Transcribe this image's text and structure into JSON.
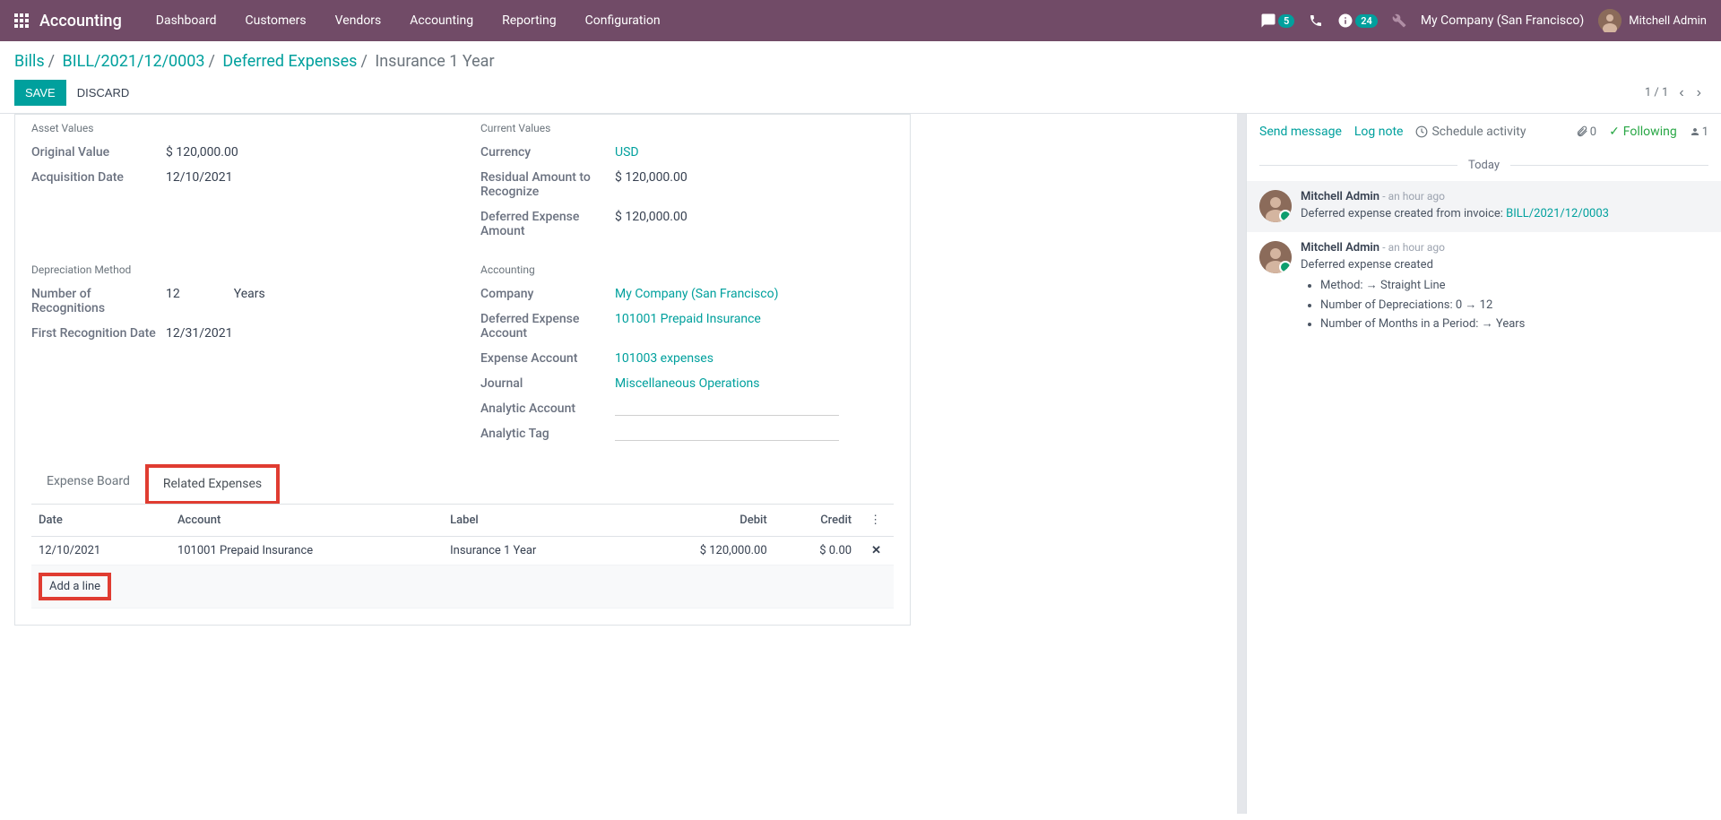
{
  "topbar": {
    "app_title": "Accounting",
    "menus": [
      "Dashboard",
      "Customers",
      "Vendors",
      "Accounting",
      "Reporting",
      "Configuration"
    ],
    "msg_badge": "5",
    "activity_badge": "24",
    "company": "My Company (San Francisco)",
    "user": "Mitchell Admin"
  },
  "breadcrumb": {
    "a": "Bills",
    "b": "BILL/2021/12/0003",
    "c": "Deferred Expenses",
    "d": "Insurance 1 Year"
  },
  "buttons": {
    "save": "Save",
    "discard": "Discard"
  },
  "pager": {
    "text": "1 / 1"
  },
  "sections": {
    "asset_values": "Asset Values",
    "current_values": "Current Values",
    "depreciation_method": "Depreciation Method",
    "accounting": "Accounting"
  },
  "fields": {
    "original_value": {
      "label": "Original Value",
      "value": "$ 120,000.00"
    },
    "acquisition_date": {
      "label": "Acquisition Date",
      "value": "12/10/2021"
    },
    "currency": {
      "label": "Currency",
      "value": "USD"
    },
    "residual": {
      "label": "Residual Amount to Recognize",
      "value": "$ 120,000.00"
    },
    "deferred_amount": {
      "label": "Deferred Expense Amount",
      "value": "$ 120,000.00"
    },
    "num_recognitions": {
      "label": "Number of Recognitions",
      "value": "12",
      "period": "Years"
    },
    "first_recognition": {
      "label": "First Recognition Date",
      "value": "12/31/2021"
    },
    "company": {
      "label": "Company",
      "value": "My Company (San Francisco)"
    },
    "deferred_account": {
      "label": "Deferred Expense Account",
      "value": "101001 Prepaid Insurance"
    },
    "expense_account": {
      "label": "Expense Account",
      "value": "101003 expenses"
    },
    "journal": {
      "label": "Journal",
      "value": "Miscellaneous Operations"
    },
    "analytic_account": {
      "label": "Analytic Account"
    },
    "analytic_tag": {
      "label": "Analytic Tag"
    }
  },
  "tabs": {
    "expense_board": "Expense Board",
    "related_expenses": "Related Expenses"
  },
  "table": {
    "headers": {
      "date": "Date",
      "account": "Account",
      "label": "Label",
      "debit": "Debit",
      "credit": "Credit"
    },
    "rows": [
      {
        "date": "12/10/2021",
        "account": "101001 Prepaid Insurance",
        "label": "Insurance 1 Year",
        "debit": "$ 120,000.00",
        "credit": "$ 0.00"
      }
    ],
    "add_line": "Add a line"
  },
  "chatter": {
    "send": "Send message",
    "log": "Log note",
    "schedule": "Schedule activity",
    "attach": "0",
    "following": "Following",
    "followers": "1",
    "today": "Today",
    "messages": [
      {
        "author": "Mitchell Admin",
        "time": "- an hour ago",
        "body_pre": "Deferred expense created from invoice: ",
        "body_link": "BILL/2021/12/0003",
        "note": true
      },
      {
        "author": "Mitchell Admin",
        "time": "- an hour ago",
        "body_pre": "Deferred expense created",
        "list": [
          {
            "label": "Method:",
            "arrow": true,
            "to": "Straight Line"
          },
          {
            "label": "Number of Depreciations:",
            "from": "0",
            "arrow": true,
            "to": "12"
          },
          {
            "label": "Number of Months in a Period:",
            "arrow": true,
            "to": "Years"
          }
        ]
      }
    ]
  }
}
